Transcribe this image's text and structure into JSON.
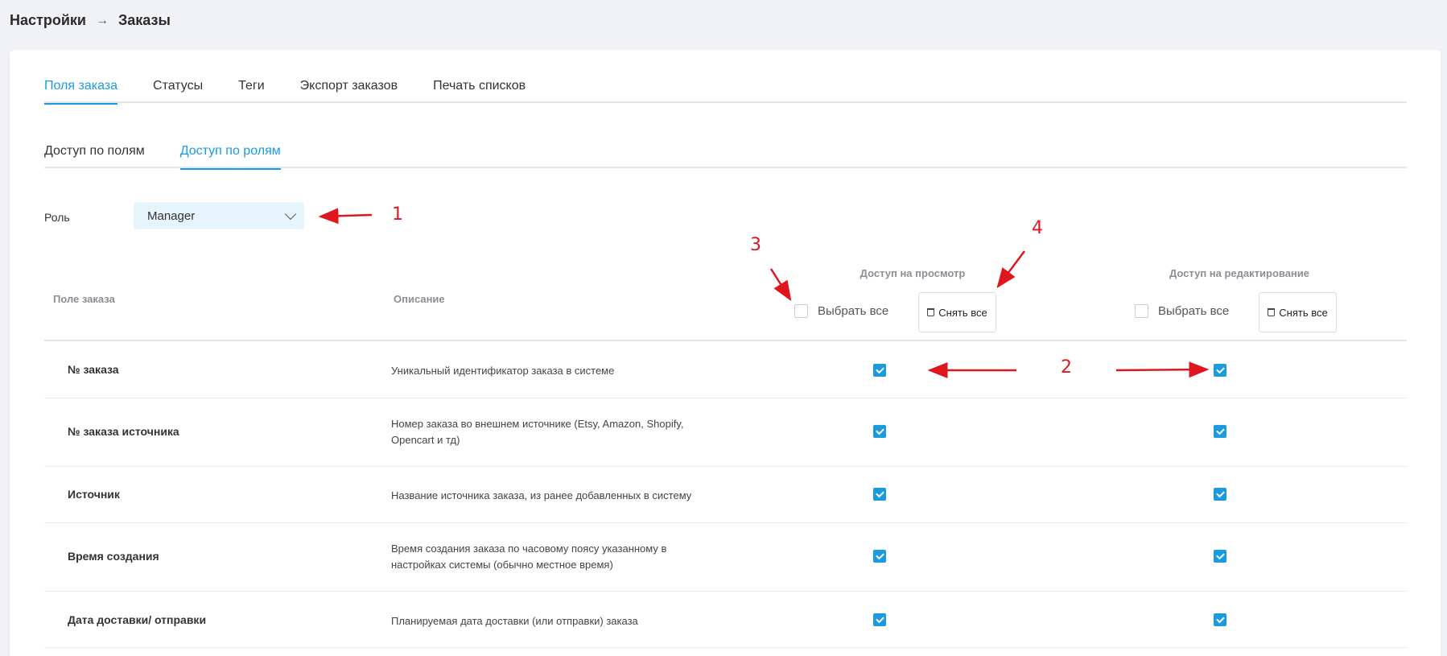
{
  "breadcrumb": {
    "root": "Настройки",
    "separator": "→",
    "current": "Заказы"
  },
  "tabs": [
    {
      "label": "Поля заказа",
      "active": true
    },
    {
      "label": "Статусы",
      "active": false
    },
    {
      "label": "Теги",
      "active": false
    },
    {
      "label": "Экспорт заказов",
      "active": false
    },
    {
      "label": "Печать списков",
      "active": false
    }
  ],
  "subtabs": [
    {
      "label": "Доступ по полям",
      "active": false
    },
    {
      "label": "Доступ по ролям",
      "active": true
    }
  ],
  "role": {
    "label": "Роль",
    "value": "Manager"
  },
  "table": {
    "col_field": "Поле заказа",
    "col_description": "Описание",
    "view_group": {
      "title": "Доступ на просмотр",
      "select_all": "Выбрать все",
      "clear_all": "Снять все"
    },
    "edit_group": {
      "title": "Доступ на редактирование",
      "select_all": "Выбрать все",
      "clear_all": "Снять все"
    },
    "rows": [
      {
        "field": "№ заказа",
        "description": "Уникальный идентификатор заказа в системе",
        "view": true,
        "edit": true
      },
      {
        "field": "№ заказа источника",
        "description": "Номер заказа во внешнем источнике (Etsy, Amazon, Shopify, Opencart и тд)",
        "view": true,
        "edit": true
      },
      {
        "field": "Источник",
        "description": "Название источника заказа, из ранее добавленных в систему",
        "view": true,
        "edit": true
      },
      {
        "field": "Время создания",
        "description": "Время создания заказа по часовому поясу указанному в настройках системы (обычно местное время)",
        "view": true,
        "edit": true
      },
      {
        "field": "Дата доставки/ отправки",
        "description": "Планируемая дата доставки (или отправки) заказа",
        "view": true,
        "edit": true
      }
    ]
  },
  "annotations": {
    "a1": "1",
    "a2": "2",
    "a3": "3",
    "a4": "4",
    "color": "#e0161e"
  },
  "accent_color": "#1a9be0"
}
